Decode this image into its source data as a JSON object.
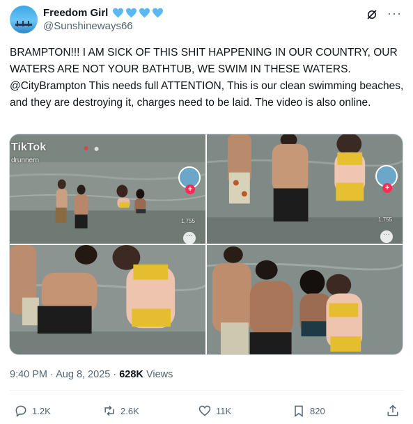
{
  "author": {
    "display_name": "Freedom Girl",
    "handle": "@Sunshineways66",
    "badge_icons": [
      "blue-heart-icon",
      "blue-heart-icon",
      "blue-heart-icon",
      "blue-heart-icon"
    ],
    "badge_color": "#5cb8f0"
  },
  "header_icons": [
    "grok-icon",
    "more-icon"
  ],
  "tweet": {
    "text": "BRAMPTON!!! I AM SICK OF THIS SHIT HAPPENING IN OUR COUNTRY, OUR WATERS ARE NOT YOUR BATHTUB, WE SWIM IN THESE WATERS. @CityBrampton This needs full ATTENTION, This is our clean swimming beaches, and they are destroying it, charges need to be laid. The video is also online."
  },
  "media": {
    "count": 4,
    "watermark": "TikTok",
    "watermark_user": "drunnern",
    "like_count_overlay": "1,755"
  },
  "meta": {
    "time": "9:40 PM",
    "separator": "·",
    "date": "Aug 8, 2025",
    "views_count": "628K",
    "views_label": "Views"
  },
  "actions": {
    "replies": "1.2K",
    "reposts": "2.6K",
    "likes": "11K",
    "bookmarks": "820"
  },
  "colors": {
    "text": "#0f1419",
    "secondary": "#536471",
    "water": "#7d8a86"
  }
}
